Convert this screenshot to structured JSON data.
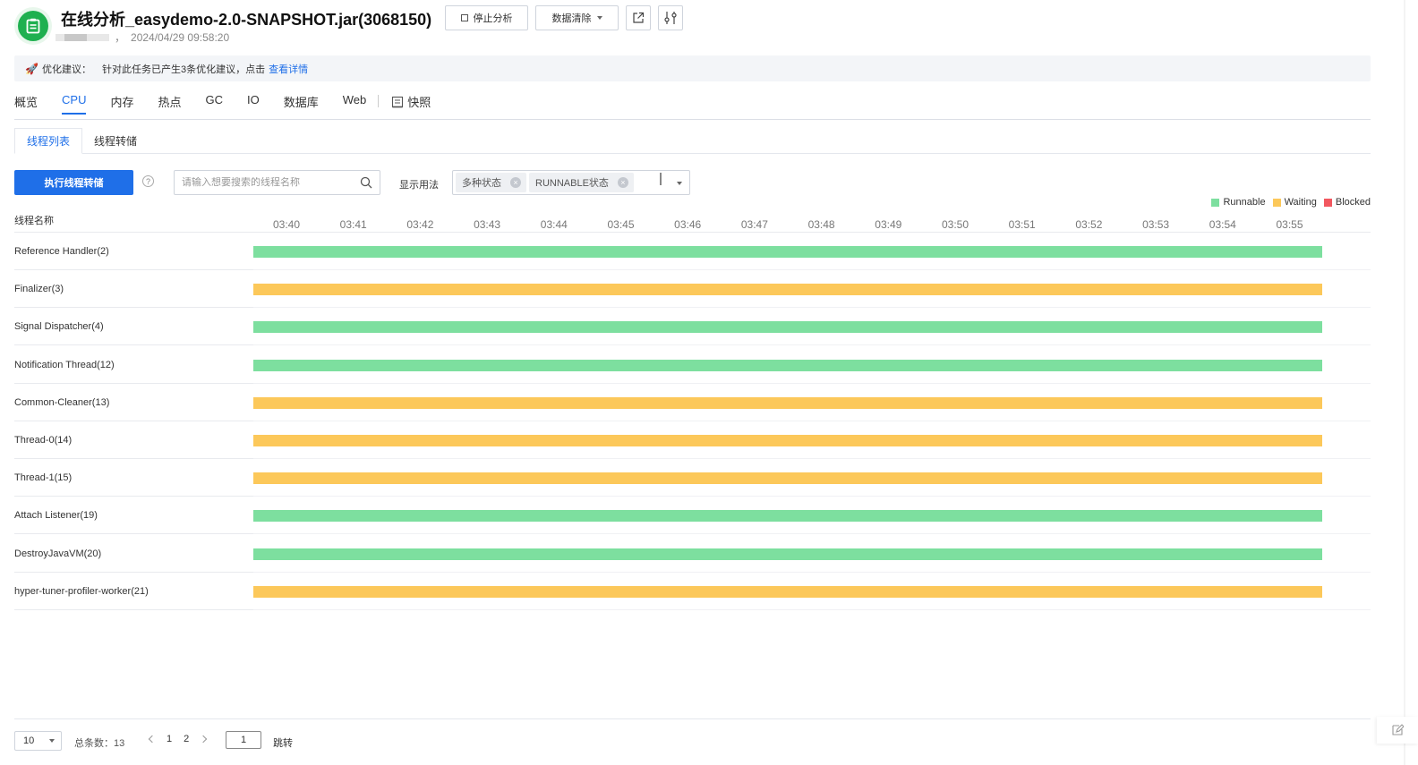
{
  "header": {
    "title": "在线分析_easydemo-2.0-SNAPSHOT.jar(3068150)",
    "timestamp": "2024/04/29 09:58:20",
    "separator": "，",
    "stop_label": "停止分析",
    "clear_label": "数据清除"
  },
  "tip": {
    "prefix": "优化建议：",
    "text": "针对此任务已产生3条优化建议，点击",
    "link": "查看详情"
  },
  "tabs": [
    "概览",
    "CPU",
    "内存",
    "热点",
    "GC",
    "IO",
    "数据库",
    "Web"
  ],
  "snapshot_tab": "快照",
  "active_tab": "CPU",
  "subtabs": [
    "线程列表",
    "线程转储"
  ],
  "toolbar": {
    "primary_label": "执行线程转储",
    "help": "?",
    "search_placeholder": "请输入想要搜索的线程名称",
    "display_label": "显示用法",
    "chips": [
      "多种状态",
      "RUNNABLE状态"
    ]
  },
  "chart_data": {
    "type": "timeline",
    "row_header": "线程名称",
    "x_ticks": [
      "03:40",
      "03:41",
      "03:42",
      "03:43",
      "03:44",
      "03:45",
      "03:46",
      "03:47",
      "03:48",
      "03:49",
      "03:50",
      "03:51",
      "03:52",
      "03:53",
      "03:54",
      "03:55"
    ],
    "legend": [
      {
        "name": "Runnable",
        "color": "#7ddf9f"
      },
      {
        "name": "Waiting",
        "color": "#fcc85a"
      },
      {
        "name": "Blocked",
        "color": "#f2575f"
      }
    ],
    "threads": [
      {
        "name": "Reference Handler(2)",
        "state": "Runnable"
      },
      {
        "name": "Finalizer(3)",
        "state": "Waiting"
      },
      {
        "name": "Signal Dispatcher(4)",
        "state": "Runnable"
      },
      {
        "name": "Notification Thread(12)",
        "state": "Runnable"
      },
      {
        "name": "Common-Cleaner(13)",
        "state": "Waiting"
      },
      {
        "name": "Thread-0(14)",
        "state": "Waiting"
      },
      {
        "name": "Thread-1(15)",
        "state": "Waiting"
      },
      {
        "name": "Attach Listener(19)",
        "state": "Runnable"
      },
      {
        "name": "DestroyJavaVM(20)",
        "state": "Runnable"
      },
      {
        "name": "hyper-tuner-profiler-worker(21)",
        "state": "Waiting"
      }
    ]
  },
  "pagination": {
    "page_size": "10",
    "total_label": "总条数：13",
    "pages": [
      "1",
      "2"
    ],
    "jump_value": "1",
    "jump_label": "跳转"
  },
  "colors": {
    "accent": "#1f6fe8",
    "runnable": "#7ddf9f",
    "waiting": "#fcc85a",
    "blocked": "#f2575f"
  }
}
